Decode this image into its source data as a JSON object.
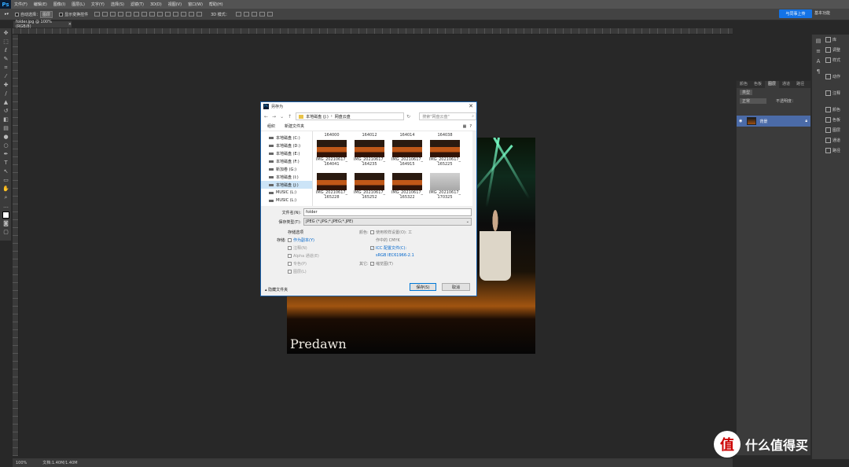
{
  "app": {
    "logo": "Ps"
  },
  "menu": [
    "文件(F)",
    "编辑(E)",
    "图像(I)",
    "图层(L)",
    "文字(Y)",
    "选择(S)",
    "滤镜(T)",
    "3D(D)",
    "视图(V)",
    "窗口(W)",
    "帮助(H)"
  ],
  "options": {
    "auto_select": "自动选择：",
    "group": "图层",
    "show_transform": "显示变换控件",
    "mode_3d": "3D 模式："
  },
  "share_label": "与同事上传",
  "workspace": "基本功能",
  "doc_tab": "folder.jpg @ 100%(RGB/8)",
  "canvas": {
    "caption": "Predawn"
  },
  "status": {
    "zoom": "100%",
    "doc": "文档:1.40M/1.40M"
  },
  "layers_panel": {
    "tabs": [
      "颜色",
      "色板",
      "图层",
      "通道",
      "路径"
    ],
    "kind": "类型",
    "blend": "正常",
    "opacity": "不透明度：",
    "layer_name": "背景"
  },
  "right_panels": [
    "库",
    "调整",
    "样式",
    "动作",
    "注释",
    "颜色",
    "色板",
    "图层",
    "通道",
    "路径"
  ],
  "dialog": {
    "title": "另存为",
    "path": [
      "本地磁盘 (J:)",
      "网盘云盘"
    ],
    "search_placeholder": "搜索\"网盘云盘\"",
    "organize": "组织",
    "new_folder": "新建文件夹",
    "tree": [
      "本地磁盘 (C:)",
      "本地磁盘 (D:)",
      "本地磁盘 (E:)",
      "本地磁盘 (F:)",
      "新加卷 (G:)",
      "本地磁盘 (I:)",
      "本地磁盘 (J:)",
      "MUSIC (L:)",
      "MUSIC (L:)"
    ],
    "files_top": [
      "164000",
      "164012",
      "164014",
      "164038"
    ],
    "files": [
      {
        "l1": "IMG_20210617_",
        "l2": "164041"
      },
      {
        "l1": "IMG_20210617_",
        "l2": "164235"
      },
      {
        "l1": "IMG_20210617_",
        "l2": "164915"
      },
      {
        "l1": "IMG_20210617_",
        "l2": "165225"
      },
      {
        "l1": "IMG_20210617_",
        "l2": "165228"
      },
      {
        "l1": "IMG_20210617_",
        "l2": "165252"
      },
      {
        "l1": "IMG_20210617_",
        "l2": "165322"
      },
      {
        "l1": "IMG_20210617_",
        "l2": "170325"
      }
    ],
    "filename_label": "文件名(N):",
    "filename": "folder",
    "filetype_label": "保存类型(T):",
    "filetype": "JPEG (*.JPG;*.JPEG;*.JPE)",
    "save_options": "存储选项",
    "storage": "存储:",
    "as_copy": "作为副本(Y)",
    "notes": "注释(N)",
    "alpha": "Alpha 通道(E)",
    "spot": "专色(P)",
    "layers": "图层(L)",
    "color": "颜色:",
    "proof": "使用校样设置(O): 工",
    "proof2": "作中的 CMYK",
    "icc": "ICC 配置文件(C):",
    "icc2": "sRGB IEC61966-2.1",
    "other": "其它:",
    "thumbnail": "缩览图(T)",
    "hide_folders": "隐藏文件夹",
    "save": "保存(S)",
    "cancel": "取消"
  },
  "watermark": "什么值得买"
}
